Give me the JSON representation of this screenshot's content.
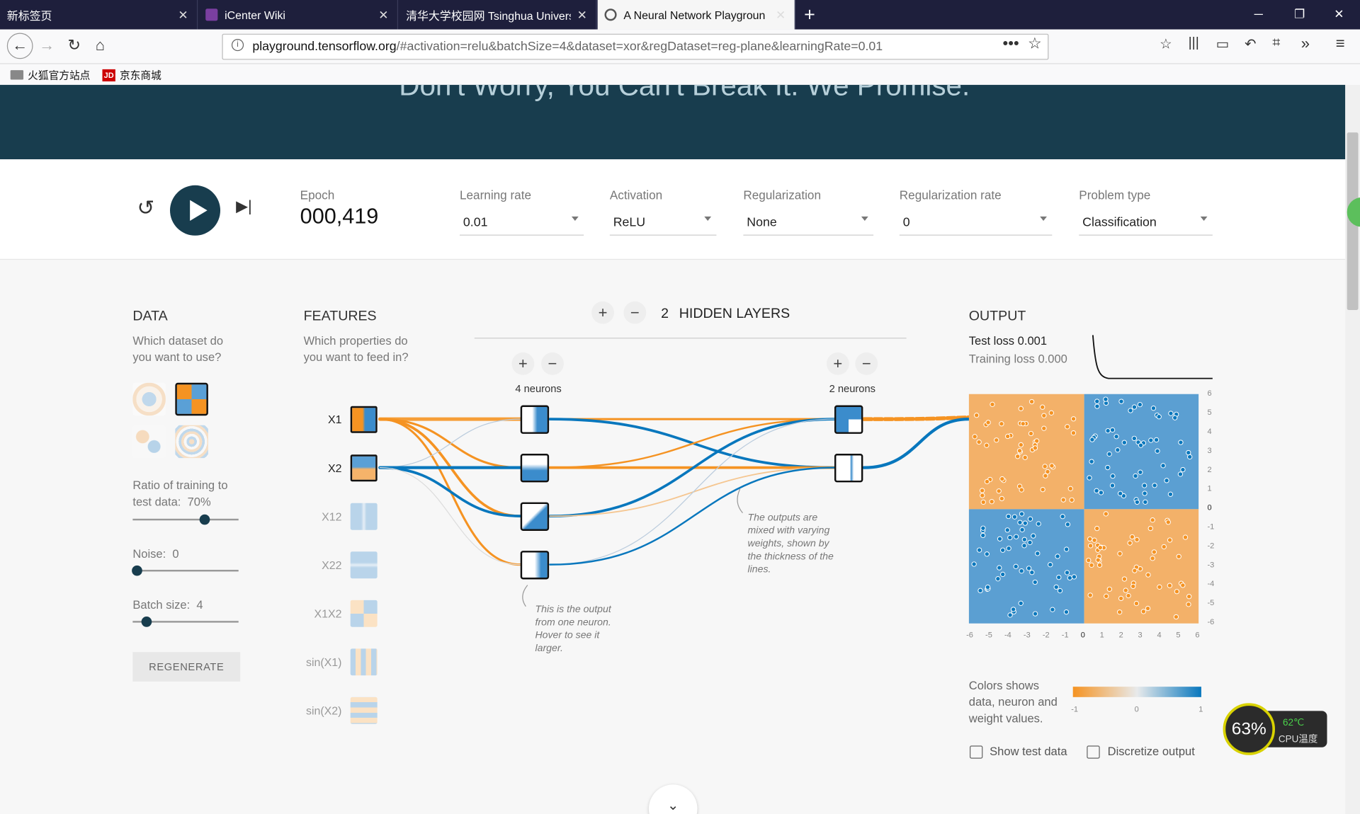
{
  "tabs": [
    {
      "title": "新标签页"
    },
    {
      "title": "iCenter Wiki"
    },
    {
      "title": "清华大学校园网 Tsinghua Univers"
    },
    {
      "title": "A Neural Network Playgroun"
    }
  ],
  "url": {
    "host": "playground.tensorflow.org",
    "path": "/#activation=relu&batchSize=4&dataset=xor&regDataset=reg-plane&learningRate=0.01"
  },
  "bookmarks": [
    {
      "label": "火狐官方站点"
    },
    {
      "label": "京东商城"
    }
  ],
  "hero_text": "Don't Worry, You Can't Break It. We Promise.",
  "controls": {
    "epoch_label": "Epoch",
    "epoch": "000,419",
    "learning_rate_label": "Learning rate",
    "learning_rate": "0.01",
    "activation_label": "Activation",
    "activation": "ReLU",
    "regularization_label": "Regularization",
    "regularization": "None",
    "reg_rate_label": "Regularization rate",
    "reg_rate": "0",
    "problem_type_label": "Problem type",
    "problem_type": "Classification"
  },
  "data": {
    "title": "DATA",
    "subtitle": "Which dataset do you want to use?",
    "ratio_label": "Ratio of training to test data:",
    "ratio": "70%",
    "ratio_fraction": 0.7,
    "noise_label": "Noise:",
    "noise": "0",
    "noise_fraction": 0,
    "batch_label": "Batch size:",
    "batch": "4",
    "batch_fraction": 0.1,
    "regenerate": "REGENERATE"
  },
  "features": {
    "title": "FEATURES",
    "subtitle": "Which properties do you want to feed in?",
    "items": [
      "X1",
      "X2",
      "X12",
      "X22",
      "X1X2",
      "sin(X1)",
      "sin(X2)"
    ]
  },
  "hidden": {
    "count": "2",
    "label": "HIDDEN LAYERS",
    "layer1": "4 neurons",
    "layer2": "2 neurons"
  },
  "notes": {
    "neuron": "This is the output from one neuron. Hover to see it larger.",
    "weights": "The outputs are mixed with varying weights, shown by the thickness of the lines."
  },
  "output": {
    "title": "OUTPUT",
    "test_loss": "Test loss 0.001",
    "training_loss": "Training loss 0.000",
    "y_ticks": [
      "6",
      "5",
      "4",
      "3",
      "2",
      "1",
      "0",
      "-1",
      "-2",
      "-3",
      "-4",
      "-5",
      "-6"
    ],
    "x_ticks": [
      "-6",
      "-5",
      "-4",
      "-3",
      "-2",
      "-1",
      "0",
      "1",
      "2",
      "3",
      "4",
      "5",
      "6"
    ],
    "legend_text": "Colors shows data, neuron and weight values.",
    "legend_ticks": [
      "-1",
      "0",
      "1"
    ],
    "show_test": "Show test data",
    "discretize": "Discretize output"
  },
  "cpu": {
    "percent": "63%",
    "temp": "62℃",
    "label": "CPU温度"
  },
  "colors": {
    "orange": "#f59322",
    "blue": "#0877bd",
    "dark": "#183d4e"
  }
}
